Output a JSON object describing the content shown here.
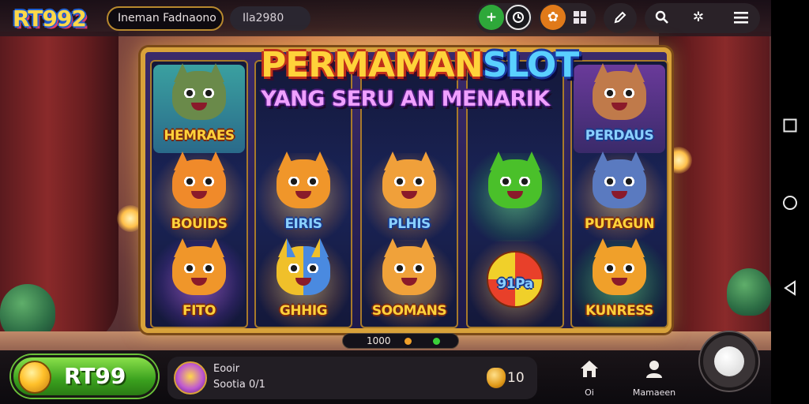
{
  "header": {
    "logo_text": "RT992",
    "search_text": "Ineman Fadnaono",
    "balance_text": "Ila2980"
  },
  "top_icons": [
    "add-icon",
    "clock-icon",
    "gift-icon",
    "grid-icon",
    "edit-icon",
    "search-icon",
    "settings-icon",
    "menu-icon"
  ],
  "slot": {
    "title_part1": "PERMAMAN",
    "title_part2": "SLOT",
    "subtitle": "YANG SERU AN MENARIK",
    "reels": [
      {
        "symbols": [
          {
            "label": "HEMRAES"
          },
          {
            "label": "BOUIDS"
          },
          {
            "label": "FITO"
          }
        ]
      },
      {
        "symbols": [
          {
            "label": ""
          },
          {
            "label": "EIRIS"
          },
          {
            "label": "GHHIG"
          }
        ]
      },
      {
        "symbols": [
          {
            "label": ""
          },
          {
            "label": "PLHIS"
          },
          {
            "label": "SOOMANS"
          }
        ]
      },
      {
        "symbols": [
          {
            "label": ""
          },
          {
            "label": ""
          },
          {
            "label": "91Pa"
          }
        ]
      },
      {
        "symbols": [
          {
            "label": "PERDAUS"
          },
          {
            "label": "PUTAGUN"
          },
          {
            "label": "KUNRESS"
          }
        ]
      }
    ],
    "progress_text": "1000"
  },
  "footer": {
    "buy_label": "RT99",
    "info_line1": "Eooir",
    "info_line2": "Sootia 0/1",
    "count": "10",
    "nav_home_label": "Oi",
    "nav_profile_label": "Mamaeen"
  },
  "colors": {
    "accent_gold": "#d8a23a",
    "buy_green": "#3aa01e",
    "title_yellow": "#ffd23a",
    "title_blue": "#5ad0ff",
    "subtitle_pink": "#f0a0ff"
  }
}
